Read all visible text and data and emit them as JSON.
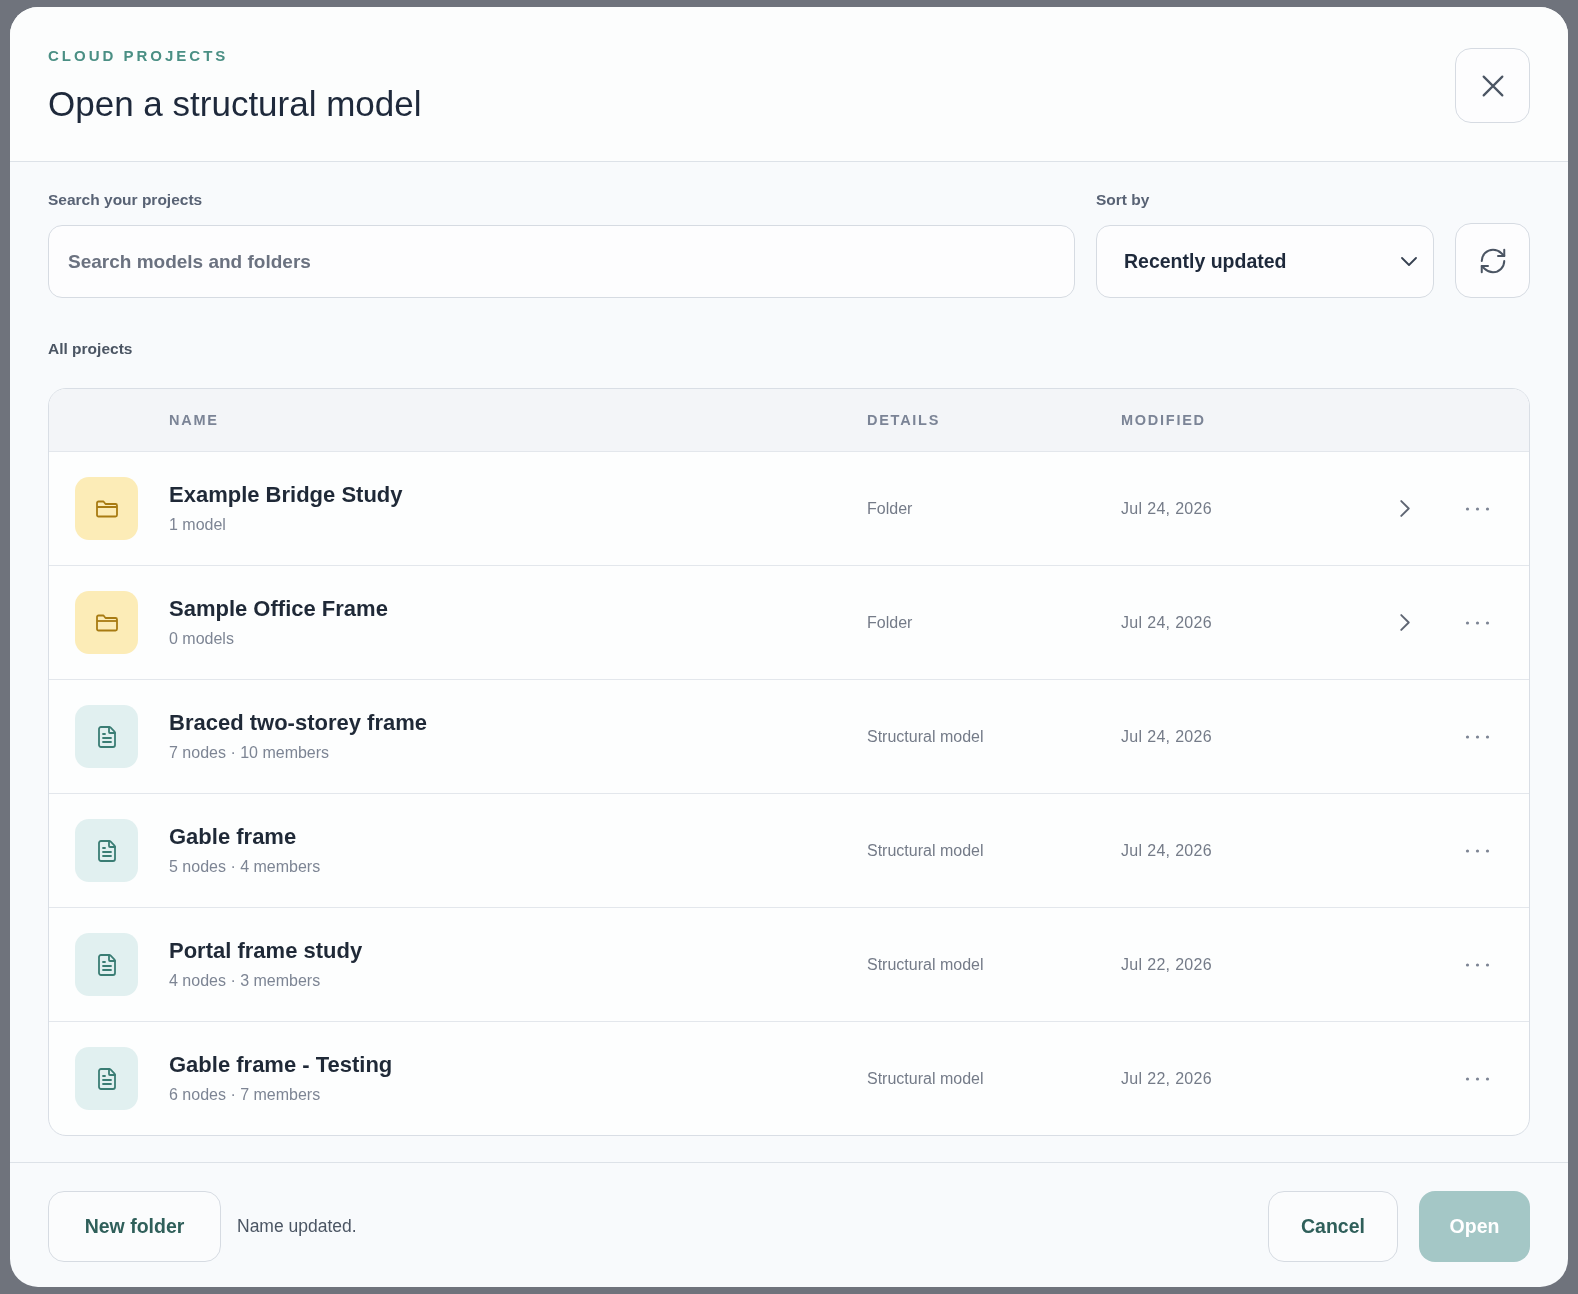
{
  "dialog": {
    "eyebrow": "CLOUD PROJECTS",
    "title": "Open a structural model"
  },
  "search": {
    "label": "Search your projects",
    "placeholder": "Search models and folders"
  },
  "sort": {
    "label": "Sort by",
    "value": "Recently updated"
  },
  "section_title": "All projects",
  "table": {
    "columns": [
      "NAME",
      "DETAILS",
      "MODIFIED"
    ],
    "rows": [
      {
        "kind": "folder",
        "name": "Example Bridge Study",
        "summary": "1 model",
        "details": "Folder",
        "modified": "Jul 24, 2026"
      },
      {
        "kind": "folder",
        "name": "Sample Office Frame",
        "summary": "0 models",
        "details": "Folder",
        "modified": "Jul 24, 2026"
      },
      {
        "kind": "model",
        "name": "Braced two-storey frame",
        "summary": "7 nodes · 10 members",
        "details": "Structural model",
        "modified": "Jul 24, 2026"
      },
      {
        "kind": "model",
        "name": "Gable frame",
        "summary": "5 nodes · 4 members",
        "details": "Structural model",
        "modified": "Jul 24, 2026"
      },
      {
        "kind": "model",
        "name": "Portal frame study",
        "summary": "4 nodes · 3 members",
        "details": "Structural model",
        "modified": "Jul 22, 2026"
      },
      {
        "kind": "model",
        "name": "Gable frame - Testing",
        "summary": "6 nodes · 7 members",
        "details": "Structural model",
        "modified": "Jul 22, 2026"
      }
    ]
  },
  "footer": {
    "new_folder": "New folder",
    "status": "Name updated.",
    "cancel": "Cancel",
    "open": {
      "label": "Open",
      "disabled": true
    }
  }
}
